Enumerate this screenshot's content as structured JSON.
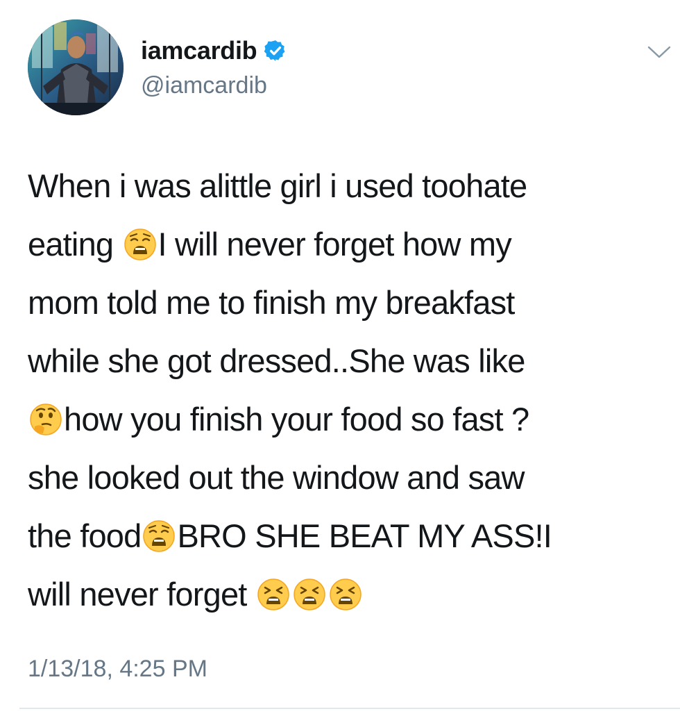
{
  "user": {
    "display_name": "iamcardib",
    "handle": "@iamcardib",
    "verified": true,
    "verified_color": "#1da1f2"
  },
  "tweet": {
    "lines": [
      {
        "parts": [
          {
            "text": "When i was alittle girl i used toohate"
          }
        ]
      },
      {
        "parts": [
          {
            "text": "eating "
          },
          {
            "emoji": "weary-face-emoji"
          },
          {
            "text": "I will never forget how my"
          }
        ]
      },
      {
        "parts": [
          {
            "text": "mom told me to finish my breakfast"
          }
        ]
      },
      {
        "parts": [
          {
            "text": "while she got dressed..She was like"
          }
        ]
      },
      {
        "parts": [
          {
            "emoji": "thinking-face-emoji"
          },
          {
            "text": "how you finish your food so fast ?"
          }
        ]
      },
      {
        "parts": [
          {
            "text": "she looked out the window and saw"
          }
        ]
      },
      {
        "parts": [
          {
            "text": "the food"
          },
          {
            "emoji": "weary-face-emoji"
          },
          {
            "text": "BRO SHE BEAT MY ASS!I"
          }
        ]
      },
      {
        "parts": [
          {
            "text": "will never forget "
          },
          {
            "emoji": "tired-face-emoji"
          },
          {
            "emoji": "tired-face-emoji"
          },
          {
            "emoji": "tired-face-emoji"
          }
        ]
      }
    ],
    "timestamp": "1/13/18, 4:25 PM"
  },
  "icons": {
    "menu": "chevron-down-icon",
    "verified": "verified-badge-icon"
  },
  "colors": {
    "text": "#14171a",
    "secondary": "#657786",
    "divider": "#e1e8ed"
  }
}
